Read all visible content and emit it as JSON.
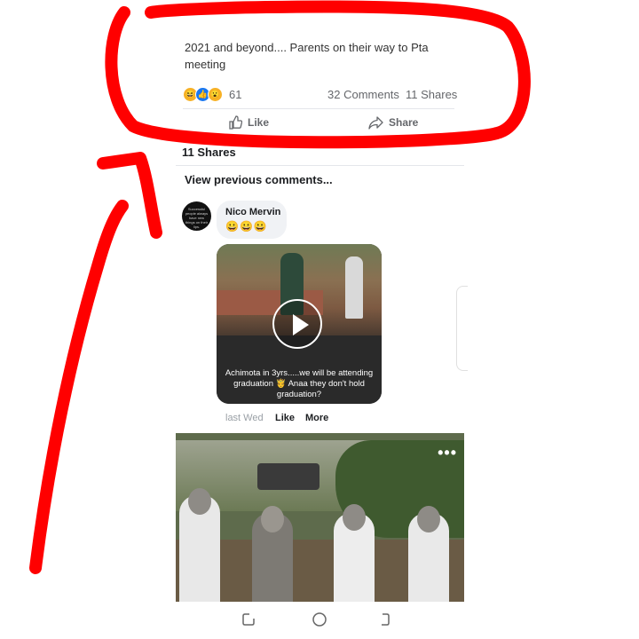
{
  "post": {
    "text": "2021 and beyond.... Parents on their way to Pta meeting",
    "reaction_count": "61",
    "comments": "32 Comments",
    "shares": "11 Shares",
    "like_label": "Like",
    "share_label": "Share"
  },
  "shares_summary": "11 Shares",
  "view_previous": "View previous comments...",
  "comment": {
    "author": "Nico Mervin",
    "emojis": "😀😀😀",
    "avatar_text": "Successful people always have new things on their lips.",
    "video_caption": "Achimota in 3yrs.....we will be attending graduation 🤴 Anaa they don't hold graduation?",
    "time": "last Wed",
    "like_label": "Like",
    "more_label": "More"
  },
  "photo": {
    "menu": "•••"
  },
  "icons": {
    "reactions": [
      "haha-icon",
      "like-icon",
      "wow-icon"
    ],
    "navbar": [
      "recents-icon",
      "home-icon",
      "back-icon"
    ]
  },
  "colors": {
    "annotation": "#ff0000",
    "like_blue": "#1877f2",
    "muted_text": "#65676b"
  }
}
